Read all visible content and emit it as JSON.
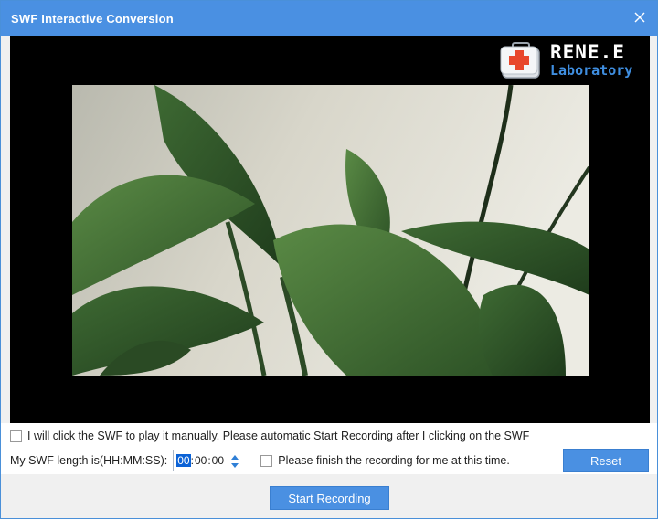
{
  "window": {
    "title": "SWF Interactive Conversion"
  },
  "logo": {
    "brand": "RENE.E",
    "sub": "Laboratory"
  },
  "options": {
    "manual_play_label": "I will click the SWF to play it manually. Please automatic Start Recording after I clicking on the SWF",
    "manual_play_checked": false,
    "length_label": "My SWF length is(HH:MM:SS):",
    "length_hours": "00",
    "length_minutes": "00",
    "length_seconds": "00",
    "finish_label": "Please finish the recording for me at this time.",
    "finish_checked": false
  },
  "buttons": {
    "reset": "Reset",
    "start_recording": "Start Recording"
  },
  "colors": {
    "accent": "#4a90e2",
    "preview_bg": "#000000"
  }
}
